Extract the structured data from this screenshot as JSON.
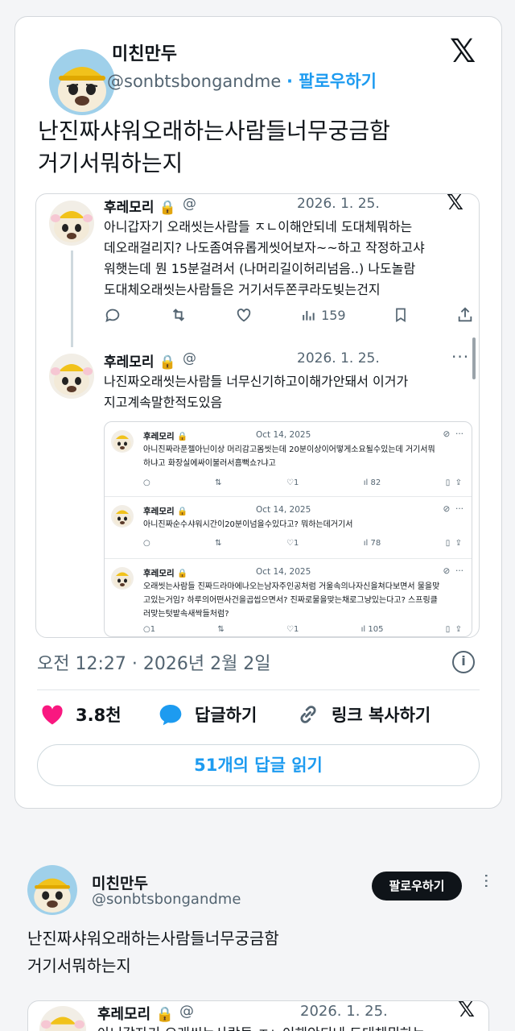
{
  "tweet": {
    "author_name": "미친만두",
    "author_handle": "@sonbtsbongandme",
    "follow_label": "· 팔로우하기",
    "text_line1": "난진짜샤워오래하는사람들너무궁금함",
    "text_line2": "거기서뭐하는지",
    "timestamp": "오전 12:27 · 2026년 2월 2일",
    "likes": "3.8천",
    "reply_label": "답글하기",
    "copy_link_label": "링크 복사하기",
    "read_replies_label": "51개의 답글 읽기"
  },
  "quote": {
    "post1": {
      "name": "후레모리",
      "handle": "@",
      "date": "2026. 1. 25.",
      "lines": [
        "아니갑자기 오래씻는사람들 ㅈㄴ이해안되네 도대체뭐하는",
        "데오래걸리지? 나도좀여유롭게씻어보자~~하고 작정하고샤",
        "워햇는데 뭔 15분걸려서 (나머리길이허리넘음..) 나도놀람",
        "도대체오래씻는사람들은 거기서두쫀쿠라도빚는건지"
      ],
      "views": "159"
    },
    "post2": {
      "name": "후레모리",
      "handle": "@",
      "date": "2026. 1. 25.",
      "lines": [
        "나진짜오래씻는사람들 너무신기하고이해가안돼서 이거가",
        "지고계속말한적도있음"
      ]
    },
    "inner": [
      {
        "name": "후레모리",
        "date": "Oct 14, 2025",
        "lines": [
          "아니진짜라푼젤아닌이상 머리감고몸씻는데 20분이상이어떻게소요될수있는데 거기서뭐",
          "하냐고 화장실에싸이불러서흠뻑쇼?냐고"
        ],
        "likes": "1",
        "views": "82"
      },
      {
        "name": "후레모리",
        "date": "Oct 14, 2025",
        "lines": [
          "아니진짜순수샤워시간이20분이넘을수있다고? 뭐하는데거기서"
        ],
        "likes": "1",
        "views": "78"
      },
      {
        "name": "후레모리",
        "date": "Oct 14, 2025",
        "lines": [
          "오래씻는사람들 진짜드라마에나오는남자주인공처럼 거울속의나자신을쳐다보면서 물을맞",
          "고있는거임? 하루의어떤사건을곱씹으면서? 진짜로물을맞는채로그냥있는다고? 스프링클",
          "러맞는텃밭속새싹들처럼?"
        ],
        "replies": "1",
        "likes": "1",
        "views": "105"
      }
    ]
  },
  "tweet2": {
    "author_name": "미친만두",
    "author_handle": "@sonbtsbongandme",
    "follow_label": "팔로우하기",
    "text_line1": "난진짜샤워오래하는사람들너무궁금함",
    "text_line2": "거기서뭐하는지",
    "quote_name": "후레모리",
    "quote_handle": "@",
    "quote_date": "2026. 1. 25.",
    "quote_line1": "아니갑자기 오래씻는사람들 ㅈㄴ이해안되네 도대체뭐하는"
  },
  "colors": {
    "accent": "#1d9bf0",
    "like": "#f91880",
    "text": "#0f1419",
    "muted": "#536471"
  },
  "icons": [
    "x-logo-icon",
    "lock-icon",
    "reply-icon",
    "retweet-icon",
    "like-icon",
    "views-icon",
    "bookmark-icon",
    "share-icon",
    "info-icon",
    "heart-icon",
    "speech-bubble-icon",
    "link-icon",
    "more-icon"
  ]
}
